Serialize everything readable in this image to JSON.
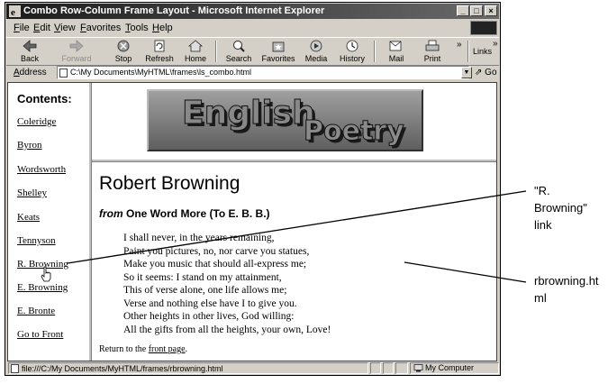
{
  "window": {
    "title": "Combo Row-Column Frame Layout - Microsoft Internet Explorer"
  },
  "menu": [
    "File",
    "Edit",
    "View",
    "Favorites",
    "Tools",
    "Help"
  ],
  "toolbar": {
    "buttons": [
      {
        "label": "Back",
        "icon": "back-arrow-icon"
      },
      {
        "label": "Forward",
        "icon": "forward-arrow-icon"
      },
      {
        "label": "Stop",
        "icon": "stop-icon"
      },
      {
        "label": "Refresh",
        "icon": "refresh-icon"
      },
      {
        "label": "Home",
        "icon": "home-icon"
      },
      {
        "label": "Search",
        "icon": "search-icon"
      },
      {
        "label": "Favorites",
        "icon": "favorites-icon"
      },
      {
        "label": "Media",
        "icon": "media-icon"
      },
      {
        "label": "History",
        "icon": "history-icon"
      },
      {
        "label": "Mail",
        "icon": "mail-icon"
      },
      {
        "label": "Print",
        "icon": "print-icon"
      }
    ],
    "links_label": "Links",
    "chevron": "»"
  },
  "address": {
    "label": "Address",
    "value": "C:\\My Documents\\MyHTML\\frames\\ls_combo.html",
    "go_label": "Go"
  },
  "left_frame": {
    "heading": "Contents:",
    "links": [
      "Coleridge",
      "Byron",
      "Wordsworth",
      "Shelley",
      "Keats",
      "Tennyson",
      "R. Browning",
      "E. Browning",
      "E. Bronte",
      "Go to Front"
    ]
  },
  "banner": {
    "word1": "English",
    "word2": "Poetry"
  },
  "main": {
    "title": "Robert Browning",
    "subtitle_italic": "from",
    "subtitle_rest": " One Word More (To E. B. B.)",
    "poem": [
      "I shall never, in the years remaining,",
      "Paint you pictures, no, nor carve you statues,",
      "Make you music that should all-express me;",
      "So it seems: I stand on my attainment,",
      "This of verse alone, one life allows me;",
      "Verse and nothing else have I to give you.",
      "Other heights in other lives, God willing:",
      "All the gifts from all the heights, your own, Love!"
    ],
    "return_prefix": "Return to the ",
    "return_link": "front page",
    "return_suffix": "."
  },
  "status": {
    "text": "file:///C:/My Documents/MyHTML/frames/rbrowning.html",
    "zone": "My Computer"
  },
  "callouts": {
    "link_callout": "\"R.\nBrowning\"\nlink",
    "file_callout": "rbrowning.ht\nml"
  },
  "colors": {
    "titlebar": "#2a2a2a",
    "chrome": "#d4d0c8",
    "banner_bg": "#7f7f7f"
  }
}
